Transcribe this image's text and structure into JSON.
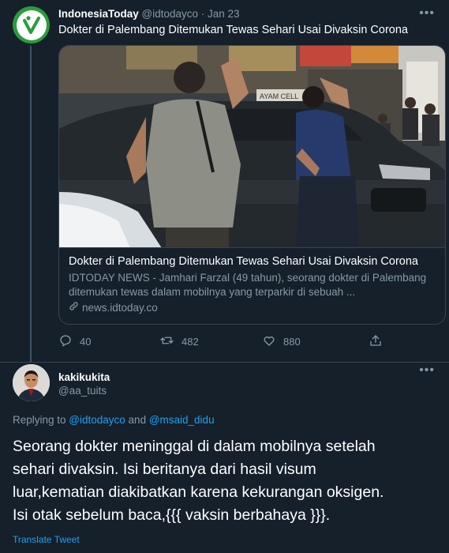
{
  "tweet1": {
    "author_name": "IndonesiaToday",
    "handle": "@idtodayco",
    "separator": " · ",
    "date": "Jan 23",
    "text": "Dokter di Palembang Ditemukan Tewas Sehari Usai Divaksin Corona",
    "card": {
      "title": "Dokter di Palembang Ditemukan Tewas Sehari Usai Divaksin Corona",
      "description": "IDTODAY NEWS - Jamhari Farzal (49 tahun), seorang dokter di Palembang ditemukan tewas dalam mobilnya yang terparkir di sebuah ...",
      "domain": "news.idtoday.co",
      "image_sign": "AYAM CELL"
    },
    "actions": {
      "replies": "40",
      "retweets": "482",
      "likes": "880"
    }
  },
  "tweet2": {
    "author_name": "kakikukita",
    "handle": "@aa_tuits",
    "replying_prefix": "Replying to ",
    "replying_to_1": "@idtodayco",
    "replying_and": " and ",
    "replying_to_2": "@msaid_didu",
    "text_lines": [
      "Seorang dokter meninggal di dalam mobilnya setelah",
      "sehari divaksin. Isi beritanya dari hasil visum",
      "luar,kematian diakibatkan karena kekurangan oksigen.",
      "Isi otak sebelum baca,{{{ vaksin berbahaya }}}."
    ],
    "translate_label": "Translate Tweet"
  },
  "colors": {
    "background": "#15202b",
    "muted": "#8899a6",
    "accent": "#1da1f2",
    "border": "#38444d",
    "logo_green": "#2a9d3c"
  }
}
